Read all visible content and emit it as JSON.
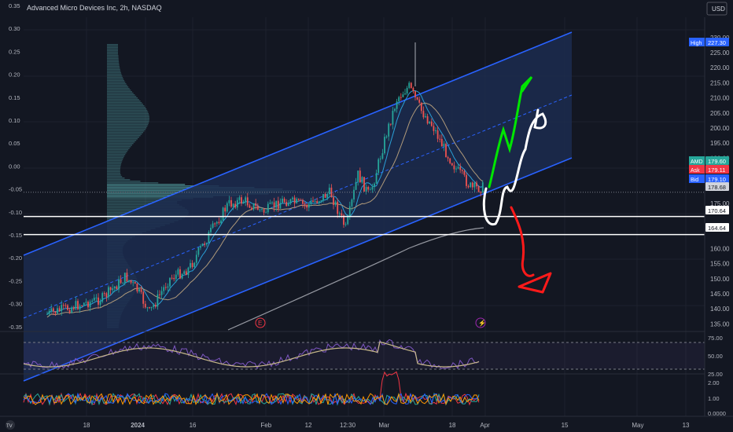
{
  "header": {
    "symbol_title": "Advanced Micro Devices Inc, 2h, NASDAQ",
    "currency": "USD"
  },
  "chart_data": {
    "type": "candlestick",
    "main_axis": {
      "right_ticks": [
        230,
        225,
        220,
        215,
        210,
        205,
        200,
        195,
        190,
        175,
        160,
        155,
        150,
        145,
        140,
        135
      ],
      "right_range": [
        133,
        231
      ],
      "left_ticks": [
        "0.35",
        "0.30",
        "0.25",
        "0.20",
        "0.15",
        "0.10",
        "0.05",
        "0.00",
        "-0.05",
        "-0.10",
        "-0.15",
        "-0.20",
        "-0.25",
        "-0.30",
        "-0.35"
      ]
    },
    "price_labels": [
      {
        "label": "High",
        "value": "227.30",
        "bg": "#2962ff"
      },
      {
        "label": "AMD",
        "value": "179.60",
        "bg": "#26a69a"
      },
      {
        "label": "Ask",
        "value": "179.11",
        "bg": "#f23645"
      },
      {
        "label": "Bid",
        "value": "179.10",
        "bg": "#2962ff"
      },
      {
        "label": "",
        "value": "178.68",
        "bg": "#d1d4dc"
      },
      {
        "label": "",
        "value": "170.64",
        "bg": "#ffffff"
      },
      {
        "label": "",
        "value": "164.64",
        "bg": "#ffffff"
      }
    ],
    "horizontal_levels": [
      170.64,
      164.64
    ],
    "x_labels": [
      "18",
      "2024",
      "16",
      "Feb",
      "12",
      "12:30",
      "Mar",
      "18",
      "Apr",
      "15",
      "May",
      "13"
    ],
    "oscillator_1": {
      "ticks": [
        "75.00",
        "50.00",
        "25.00"
      ],
      "range": [
        20,
        80
      ],
      "bands": [
        70,
        30
      ]
    },
    "oscillator_2": {
      "ticks": [
        "2.00",
        "1.00",
        "0.0000"
      ],
      "range": [
        -0.1,
        2.6
      ]
    },
    "colors": {
      "up": "#26a69a",
      "down": "#ef5350",
      "channel": "#2962ff",
      "channel_fill": "#1c2b4f",
      "bull_path": "#00e600",
      "bear_path": "#ff1a1a",
      "white_path": "#ffffff",
      "volume_profile": "#4a8b8f",
      "ma_slow": "#9598a1"
    },
    "event_markers": [
      {
        "kind": "earnings",
        "glyph": "E"
      },
      {
        "kind": "dividend",
        "glyph": "⚡"
      }
    ]
  },
  "footer": {
    "logo": "TV"
  }
}
